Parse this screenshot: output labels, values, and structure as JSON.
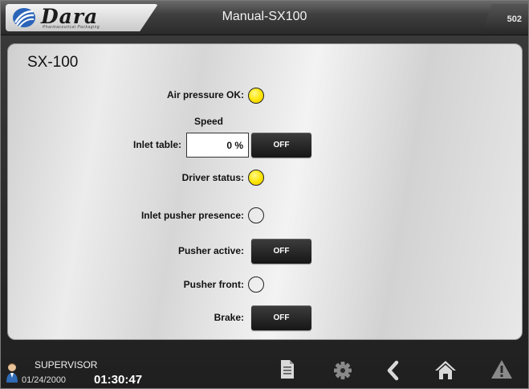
{
  "header": {
    "brand": "Dara",
    "brand_tagline": "Pharmaceutical Packaging",
    "title": "Manual-SX100",
    "screen_number": "502"
  },
  "panel": {
    "title": "SX-100",
    "air_pressure": {
      "label": "Air pressure OK:",
      "state": "on"
    },
    "speed_heading": "Speed",
    "inlet_table": {
      "label": "Inlet table:",
      "value": "0",
      "unit": "%",
      "button": "OFF"
    },
    "driver_status": {
      "label": "Driver status:",
      "state": "on"
    },
    "inlet_pusher_presence": {
      "label": "Inlet pusher presence:",
      "state": "off"
    },
    "pusher_active": {
      "label": "Pusher active:",
      "button": "OFF"
    },
    "pusher_front": {
      "label": "Pusher front:",
      "state": "off"
    },
    "brake": {
      "label": "Brake:",
      "button": "OFF"
    }
  },
  "footer": {
    "user": "SUPERVISOR",
    "date": "01/24/2000",
    "time": "01:30:47",
    "icons": [
      "document-icon",
      "gear-icon",
      "back-icon",
      "home-icon",
      "alarm-icon"
    ]
  },
  "colors": {
    "lamp_on": "#ffe400",
    "button_bg": "#1f1f1f",
    "frame_bg": "#2a2a2a"
  }
}
